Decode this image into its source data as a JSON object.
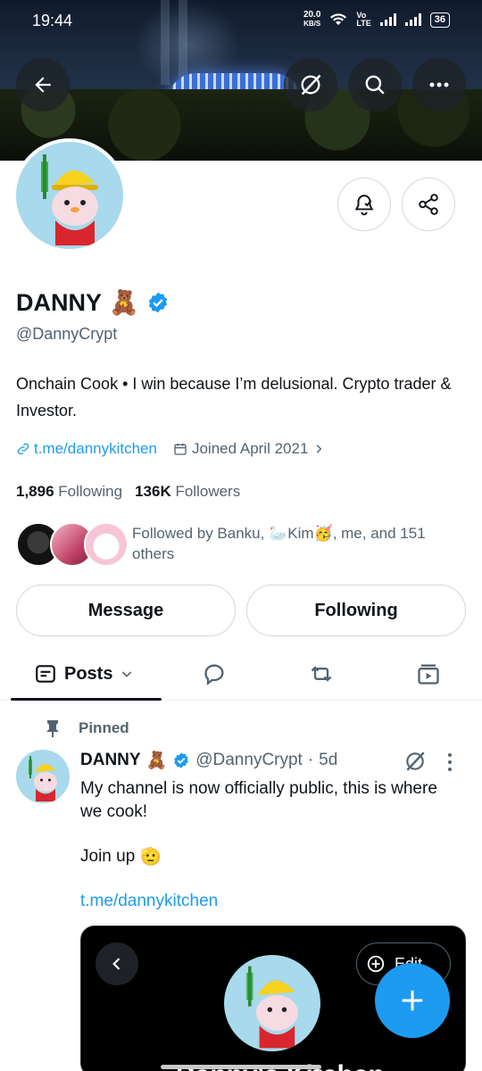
{
  "status_bar": {
    "time": "19:44",
    "net_speed": "20.0",
    "net_unit": "KB/S",
    "volte": "Vo\nLTE",
    "battery": "36"
  },
  "header": {
    "back_icon": "arrow-left-icon",
    "grok_icon": "grok-icon",
    "search_icon": "search-icon",
    "more_icon": "more-horizontal-icon"
  },
  "profile": {
    "name": "DANNY",
    "name_emoji": "🧸",
    "verified": true,
    "handle": "@DannyCrypt",
    "bio": "Onchain Cook • I win because I’m delusional. Crypto trader & Investor.",
    "link": "t.me/dannykitchen",
    "joined": "Joined April 2021",
    "following_count": "1,896",
    "following_label": "Following",
    "followers_count": "136K",
    "followers_label": "Followers",
    "followed_by": "Followed by Banku, 🦢Kim🥳, me, and 151 others"
  },
  "actions": {
    "message": "Message",
    "following": "Following"
  },
  "tabs": {
    "posts": "Posts"
  },
  "pinned_post": {
    "pinned_label": "Pinned",
    "author_name": "DANNY",
    "author_emoji": "🧸",
    "author_handle": "@DannyCrypt",
    "separator": "·",
    "time": "5d",
    "text": "My channel is now officially public, this is where we cook!",
    "text2": "Join up",
    "text2_emoji": "🫡",
    "link": "t.me/dannykitchen",
    "media_edit": "Edit",
    "media_title": "Danny's Kitchen"
  },
  "colors": {
    "accent": "#1d9bf0",
    "verified": "#1d9bf0",
    "text_primary": "#0f1419",
    "text_secondary": "#536471"
  }
}
